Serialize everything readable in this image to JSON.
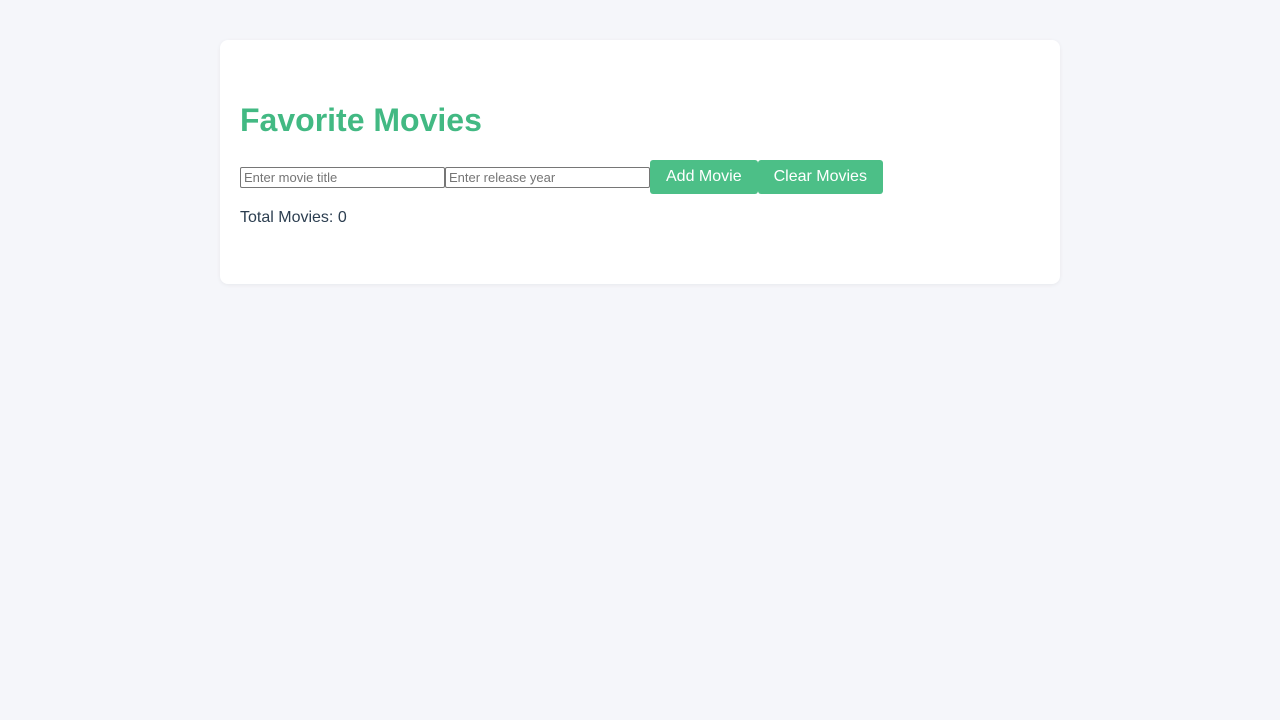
{
  "app": {
    "title": "Favorite Movies"
  },
  "form": {
    "title_input": {
      "value": "",
      "placeholder": "Enter movie title"
    },
    "year_input": {
      "value": "",
      "placeholder": "Enter release year"
    },
    "add_label": "Add Movie",
    "clear_label": "Clear Movies"
  },
  "stats": {
    "total_text": "Total Movies: 0",
    "total_count": 0
  },
  "colors": {
    "accent": "#42b983",
    "button": "#4cbf87",
    "text": "#2c3e50",
    "background": "#f5f6fa",
    "card": "#ffffff"
  }
}
